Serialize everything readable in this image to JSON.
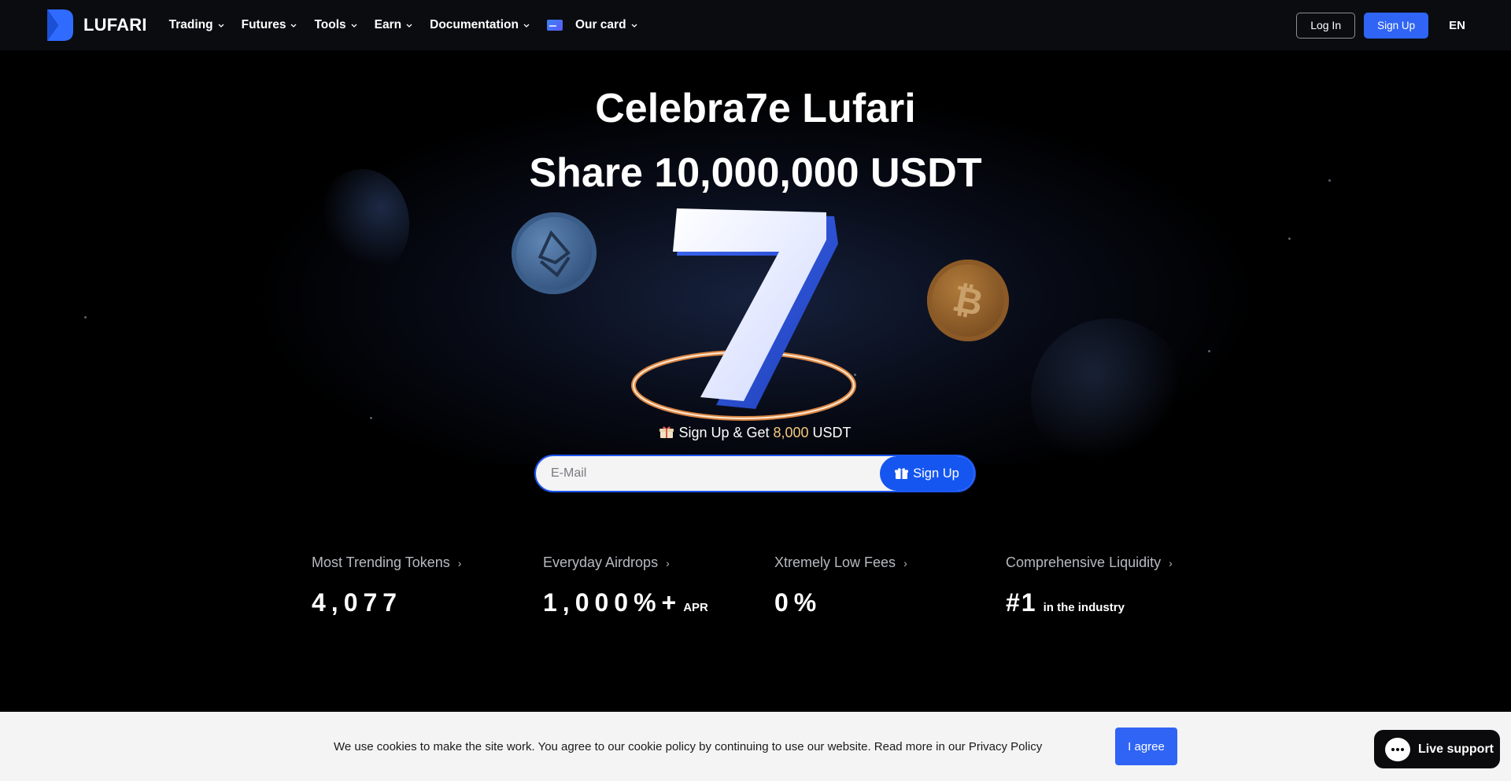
{
  "nav": {
    "brand": "LUFARI",
    "items": [
      {
        "label": "Trading"
      },
      {
        "label": "Futures"
      },
      {
        "label": "Tools"
      },
      {
        "label": "Earn"
      },
      {
        "label": "Documentation"
      },
      {
        "label": "Our card"
      }
    ],
    "login_label": "Log In",
    "signup_label": "Sign Up",
    "language": "EN"
  },
  "hero": {
    "title_line1": "Celebra7e  Lufari",
    "title_line2": "Share 10,000,000 USDT",
    "cta_prefix": "Sign Up & Get ",
    "cta_amount": "8,000",
    "cta_suffix": " USDT",
    "email_placeholder": "E-Mail",
    "signup_button": "Sign Up"
  },
  "stats": [
    {
      "label": "Most Trending Tokens",
      "value": "4,077",
      "suffix": ""
    },
    {
      "label": "Everyday Airdrops",
      "value": "1,000%+",
      "suffix": "APR"
    },
    {
      "label": "Xtremely Low Fees",
      "value": "0%",
      "suffix": ""
    },
    {
      "label": "Comprehensive Liquidity",
      "value": "#1",
      "suffix": "in the industry"
    }
  ],
  "cookie": {
    "text": "We use cookies to make the site work. You agree to our cookie policy by continuing to use our website. Read more in our Privacy Policy",
    "agree_label": "I agree"
  },
  "support": {
    "label": "Live support"
  },
  "colors": {
    "accent": "#2f64f5",
    "amount": "#f6c97d",
    "background": "#000000"
  }
}
